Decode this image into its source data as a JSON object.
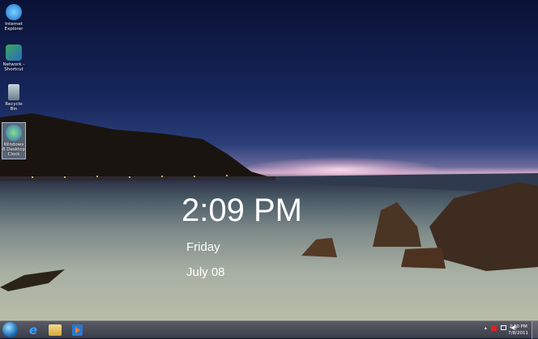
{
  "desktop": {
    "icons": [
      {
        "label": "Internet Explorer",
        "icon": "internet-explorer-icon"
      },
      {
        "label": "Network - Shortcut",
        "icon": "network-icon"
      },
      {
        "label": "Recycle Bin",
        "icon": "recycle-bin-icon"
      },
      {
        "label": "Windows 8 Desktop Clock",
        "icon": "clock-globe-icon",
        "selected": true
      }
    ]
  },
  "clock_widget": {
    "time": "2:09 PM",
    "day": "Friday",
    "date": "July 08"
  },
  "taskbar": {
    "pinned": [
      {
        "name": "internet-explorer"
      },
      {
        "name": "windows-explorer"
      },
      {
        "name": "windows-media-player"
      }
    ],
    "tray": {
      "expand": "▴",
      "time": "2:10 PM",
      "date": "7/8/2011"
    }
  }
}
